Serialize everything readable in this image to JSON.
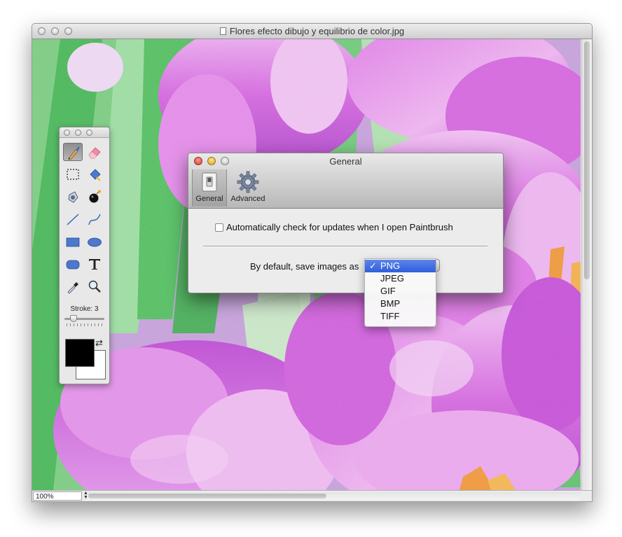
{
  "window": {
    "title": "Flores efecto dibujo y equilibrio de color.jpg",
    "file_icon": "document-icon"
  },
  "canvas": {
    "description_icon": "photo-canvas",
    "colors": {
      "magenta": "#d65fe0",
      "light_pink": "#f0b6f2",
      "purple": "#a936c6",
      "green": "#5cc966",
      "leaf_light": "#c4e9c4",
      "orange": "#f39a2a"
    }
  },
  "status": {
    "zoom": "100%"
  },
  "tools": {
    "items": [
      {
        "name": "brush-tool",
        "icon": "paintbrush-icon",
        "selected": true
      },
      {
        "name": "eraser-tool",
        "icon": "eraser-icon"
      },
      {
        "name": "selection-tool",
        "icon": "marquee-icon"
      },
      {
        "name": "fill-tool",
        "icon": "paint-bucket-icon"
      },
      {
        "name": "dropper-tool",
        "icon": "ink-bottle-icon"
      },
      {
        "name": "bomb-tool",
        "icon": "bomb-icon"
      },
      {
        "name": "line-tool",
        "icon": "line-icon"
      },
      {
        "name": "curve-tool",
        "icon": "curve-icon"
      },
      {
        "name": "rectangle-tool",
        "icon": "rectangle-icon"
      },
      {
        "name": "ellipse-tool",
        "icon": "ellipse-icon"
      },
      {
        "name": "rounded-rect-tool",
        "icon": "rounded-rectangle-icon"
      },
      {
        "name": "text-tool",
        "icon": "text-icon"
      },
      {
        "name": "eyedropper-tool",
        "icon": "eyedropper-icon"
      },
      {
        "name": "zoom-tool",
        "icon": "magnifier-icon"
      }
    ],
    "stroke_label": "Stroke: 3",
    "stroke_value": 3,
    "foreground_color": "#000000",
    "background_color": "#ffffff"
  },
  "preferences": {
    "title": "General",
    "tabs": [
      {
        "label": "General",
        "icon": "switch-icon",
        "selected": true
      },
      {
        "label": "Advanced",
        "icon": "gear-icon",
        "selected": false
      }
    ],
    "auto_update_label": "Automatically check for updates when I open Paintbrush",
    "auto_update_checked": false,
    "save_format_label": "By default, save images as",
    "selected_format": "PNG",
    "format_options": [
      "PNG",
      "JPEG",
      "GIF",
      "BMP",
      "TIFF"
    ],
    "checkmark": "✓"
  }
}
